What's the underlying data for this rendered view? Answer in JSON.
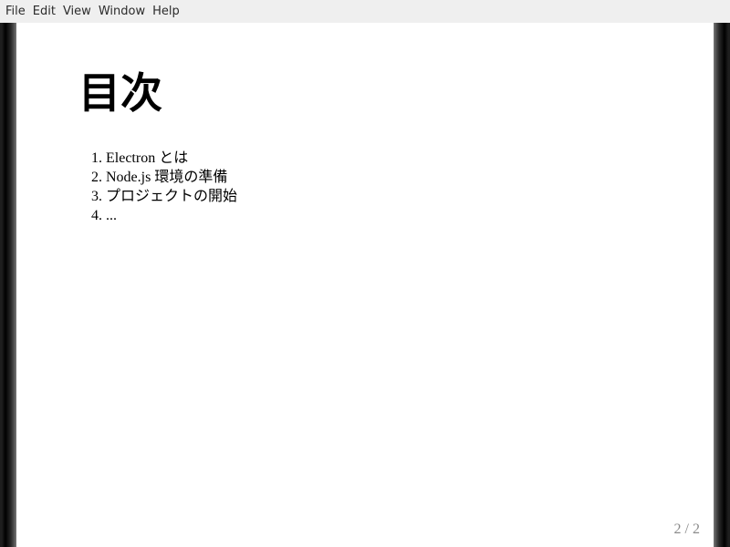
{
  "menubar": {
    "items": [
      "File",
      "Edit",
      "View",
      "Window",
      "Help"
    ]
  },
  "slide": {
    "title": "目次",
    "toc": [
      {
        "number": "1.",
        "text": "Electron とは"
      },
      {
        "number": "2.",
        "text": "Node.js 環境の準備"
      },
      {
        "number": "3.",
        "text": "プロジェクトの開始"
      },
      {
        "number": "4.",
        "text": "..."
      }
    ],
    "page_indicator": "2 / 2"
  },
  "colors": {
    "menubar_bg": "#efefef",
    "stage_bg": "#000000",
    "slide_bg": "#ffffff",
    "page_indicator": "#8a8a8a"
  }
}
